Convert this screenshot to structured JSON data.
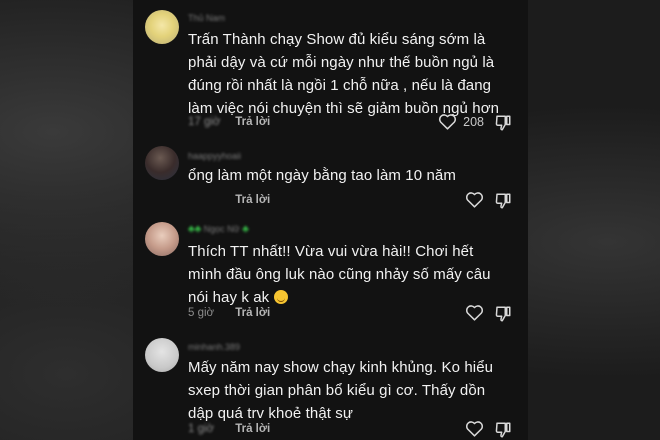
{
  "comments": [
    {
      "username": "Thủ Nam",
      "text_lines": [
        "Trấn Thành chạy Show đủ kiểu sáng sớm là",
        "phải dậy và cứ mỗi ngày như thế buồn ngủ là",
        "đúng rồi nhất là ngồi 1 chỗ nữa , nếu là đang",
        "làm việc nói chuyện thì sẽ giảm buồn ngủ hơn"
      ],
      "time": "17 giờ",
      "reply_label": "Trả lời",
      "likes": "208"
    },
    {
      "username": "haappyyhoaii",
      "text_lines": [
        "ổng làm một ngày bằng tao làm 10 năm"
      ],
      "time": "",
      "reply_label": "Trả lời",
      "likes": ""
    },
    {
      "username": "Ngọc Nữ",
      "text_lines": [
        "Thích TT nhất!! Vừa vui vừa hài!! Chơi hết",
        "mình đầu ông luk nào cũng nhảy số mấy câu",
        "nói hay k ak"
      ],
      "time": "5 giờ",
      "reply_label": "Trả lời",
      "likes": ""
    },
    {
      "username": "minhanh.389",
      "text_lines": [
        "Mấy năm nay show chạy kinh khủng. Ko hiểu",
        "sxep thời gian phân bổ kiểu gì cơ. Thấy dồn",
        "dập quá trv khoẻ thật sự"
      ],
      "time": "1 giờ",
      "reply_label": "Trả lời",
      "likes": ""
    }
  ],
  "colors": {
    "panel": "#121212",
    "text": "#f2f2f2",
    "meta": "#8b8b8b",
    "badge": "#38c24a"
  },
  "icons": {
    "like": "heart-outline-icon",
    "dislike": "thumbs-down-icon",
    "emoji": "shushing-face-emoji"
  }
}
